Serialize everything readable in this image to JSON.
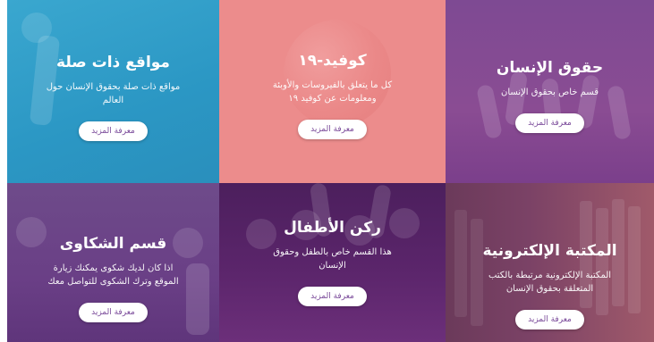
{
  "tiles": {
    "human_rights": {
      "title": "حقوق الإنسان",
      "description": "قسم خاص بحقوق الإنسان",
      "button_label": "معرفة المزيد"
    },
    "covid": {
      "title": "كوفيد-١٩",
      "description": "كل ما يتعلق بالفيروسات والأوبئة ومعلومات عن كوفيد ١٩",
      "button_label": "معرفة المزيد"
    },
    "related_sites": {
      "title": "مواقع ذات صلة",
      "description": "مواقع ذات صلة بحقوق الإنسان حول العالم",
      "button_label": "معرفة المزيد"
    },
    "e_library": {
      "title": "المكتبة الإلكترونية",
      "description": "المكتبة الإلكترونية مرتبطة بالكتب المتعلقة بحقوق الإنسان",
      "button_label": "معرفة المزيد"
    },
    "kids_corner": {
      "title": "ركن الأطفال",
      "description": "هذا القسم خاص بالطفل وحقوق الإنسان",
      "button_label": "معرفة المزيد"
    },
    "complaints": {
      "title": "قسم الشكاوى",
      "description": "اذا كان لديك شكوى يمكنك زيارة الموقع وترك الشكوى للتواصل معك",
      "button_label": "معرفة المزيد"
    }
  }
}
